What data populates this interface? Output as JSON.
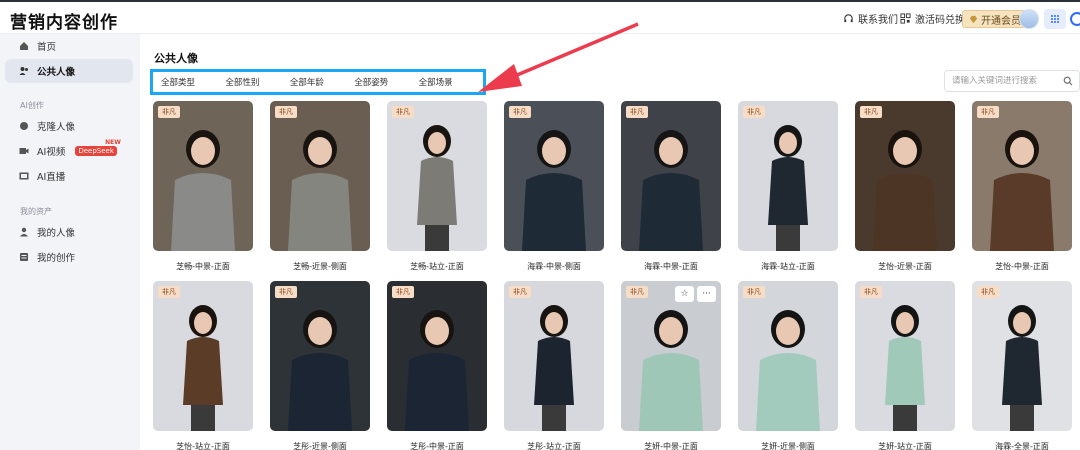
{
  "app": {
    "title": "营销内容创作"
  },
  "topbar": {
    "contact": "联系我们",
    "redeem": "激活码兑换",
    "vip": "开通会员"
  },
  "sidebar": {
    "items": [
      {
        "label": "首页",
        "icon": "home-icon"
      },
      {
        "label": "公共人像",
        "icon": "users-icon"
      }
    ],
    "section_ai": "AI创作",
    "ai_items": [
      {
        "label": "克隆人像",
        "icon": "clone-icon"
      },
      {
        "label": "AI视频",
        "icon": "video-icon",
        "badge": "DeepSeek",
        "badge_new": "NEW"
      },
      {
        "label": "AI直播",
        "icon": "live-icon"
      }
    ],
    "section_assets": "我的资产",
    "asset_items": [
      {
        "label": "我的人像",
        "icon": "person-icon"
      },
      {
        "label": "我的创作",
        "icon": "works-icon"
      }
    ]
  },
  "main": {
    "title": "公共人像",
    "filters": [
      "全部类型",
      "全部性别",
      "全部年龄",
      "全部姿势",
      "全部场景"
    ],
    "search_placeholder": "请输入关键词进行搜索",
    "tag_label": "非凡",
    "cards_row1": [
      {
        "label": "芝畅-中景-正面",
        "bg": "#6f6458",
        "outfit": "#8a8a88",
        "hair": "#1a1410"
      },
      {
        "label": "芝畅-近景-侧面",
        "bg": "#6a5e52",
        "outfit": "#858580",
        "hair": "#1a1410"
      },
      {
        "label": "芝畅-站立-正面",
        "bg": "#d9dbe1",
        "outfit": "#7d7b76",
        "hair": "#1a1410"
      },
      {
        "label": "海霖-中景-侧面",
        "bg": "#4b5058",
        "outfit": "#1e2a36",
        "hair": "#151515"
      },
      {
        "label": "海霖-中景-正面",
        "bg": "#3f4249",
        "outfit": "#1e2a36",
        "hair": "#151515"
      },
      {
        "label": "海霖-站立-正面",
        "bg": "#d7d9df",
        "outfit": "#1f2730",
        "hair": "#151515"
      },
      {
        "label": "芝怡-近景-正面",
        "bg": "#4a3a2e",
        "outfit": "#4c3524",
        "hair": "#1a120d"
      },
      {
        "label": "芝怡-中景-正面",
        "bg": "#8a7a6c",
        "outfit": "#5a3a28",
        "hair": "#1a120d"
      }
    ],
    "cards_row2": [
      {
        "label": "芝怡-站立-正面",
        "bg": "#d8dadf",
        "outfit": "#5a3c27",
        "hair": "#1a120d"
      },
      {
        "label": "芝彤-近景-侧面",
        "bg": "#2e3338",
        "outfit": "#1b2533",
        "hair": "#171310"
      },
      {
        "label": "芝彤-中景-正面",
        "bg": "#2a2e33",
        "outfit": "#1b2533",
        "hair": "#171310"
      },
      {
        "label": "芝彤-站立-正面",
        "bg": "#d6d8dd",
        "outfit": "#1c2430",
        "hair": "#171310"
      },
      {
        "label": "芝妍-中景-正面",
        "bg": "#c9ccd1",
        "outfit": "#9fc7b8",
        "hair": "#141414"
      },
      {
        "label": "芝妍-近景-侧面",
        "bg": "#d3d6da",
        "outfit": "#a3cbbd",
        "hair": "#141414"
      },
      {
        "label": "芝妍-站立-正面",
        "bg": "#d9dbe0",
        "outfit": "#a0c9ba",
        "hair": "#141414"
      },
      {
        "label": "海霖-全景-正面",
        "bg": "#dfe1e5",
        "outfit": "#1f2730",
        "hair": "#151515"
      }
    ]
  },
  "colors": {
    "accent": "#2f6bff",
    "filter_highlight": "#1aa7f5",
    "annotation_arrow": "#ec3b4d",
    "tag_bg": "#f7dcc6"
  }
}
